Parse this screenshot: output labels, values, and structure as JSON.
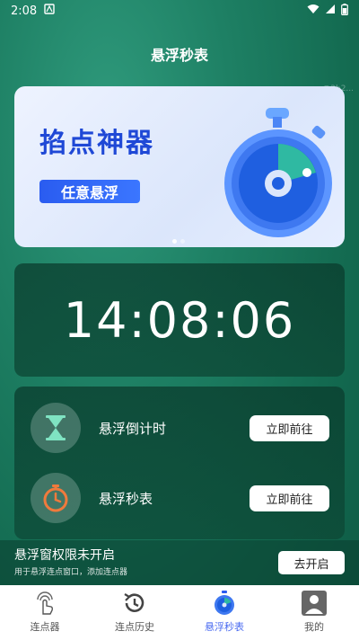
{
  "status_bar": {
    "time": "2:08"
  },
  "header": {
    "title": "悬浮秒表"
  },
  "watermark": "@2b2...",
  "banner": {
    "title": "掐点神器",
    "pill": "任意悬浮"
  },
  "clock": {
    "time": "14:08:06"
  },
  "tools": [
    {
      "label": "悬浮倒计时",
      "button": "立即前往",
      "icon": "hourglass-icon"
    },
    {
      "label": "悬浮秒表",
      "button": "立即前往",
      "icon": "stopwatch-icon"
    }
  ],
  "permission": {
    "title": "悬浮窗权限未开启",
    "subtitle": "用于悬浮连点窗口，添加连点器",
    "button": "去开启"
  },
  "tabbar": [
    {
      "label": "连点器",
      "icon": "tap-hand-icon"
    },
    {
      "label": "连点历史",
      "icon": "history-clock-icon"
    },
    {
      "label": "悬浮秒表",
      "icon": "stopwatch-icon",
      "active": true
    },
    {
      "label": "我的",
      "icon": "person-icon"
    }
  ],
  "colors": {
    "accent": "#4a6bf0",
    "brand_green": "#1e8064",
    "countdown_icon": "#7fe3c2",
    "stopwatch_icon": "#f07a3c"
  }
}
